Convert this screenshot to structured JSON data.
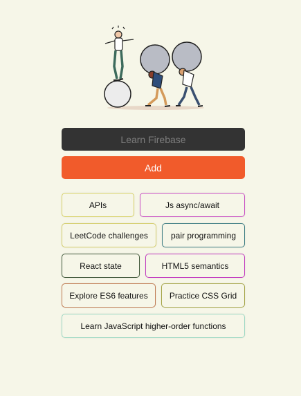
{
  "hero": {
    "icon": "people-pushing-boulders-illustration"
  },
  "form": {
    "placeholder": "Learn Firebase",
    "add_label": "Add"
  },
  "items": [
    {
      "label": "APIs",
      "border": "#d8d26a"
    },
    {
      "label": "Js async/await",
      "border": "#c94fc4"
    },
    {
      "label": "LeetCode challenges",
      "border": "#d4cd6b"
    },
    {
      "label": "pair programming",
      "border": "#3c7c82"
    },
    {
      "label": "React state",
      "border": "#435a3c"
    },
    {
      "label": "HTML5 semantics",
      "border": "#c23bc0"
    },
    {
      "label": "Explore ES6 features",
      "border": "#c07b52"
    },
    {
      "label": "Practice CSS Grid",
      "border": "#a5a548"
    },
    {
      "label": "Learn JavaScript higher-order functions",
      "border": "#9fd9c4"
    }
  ],
  "colors": {
    "background": "#f6f6e8",
    "input": "#333333",
    "accent": "#f15b2b"
  }
}
